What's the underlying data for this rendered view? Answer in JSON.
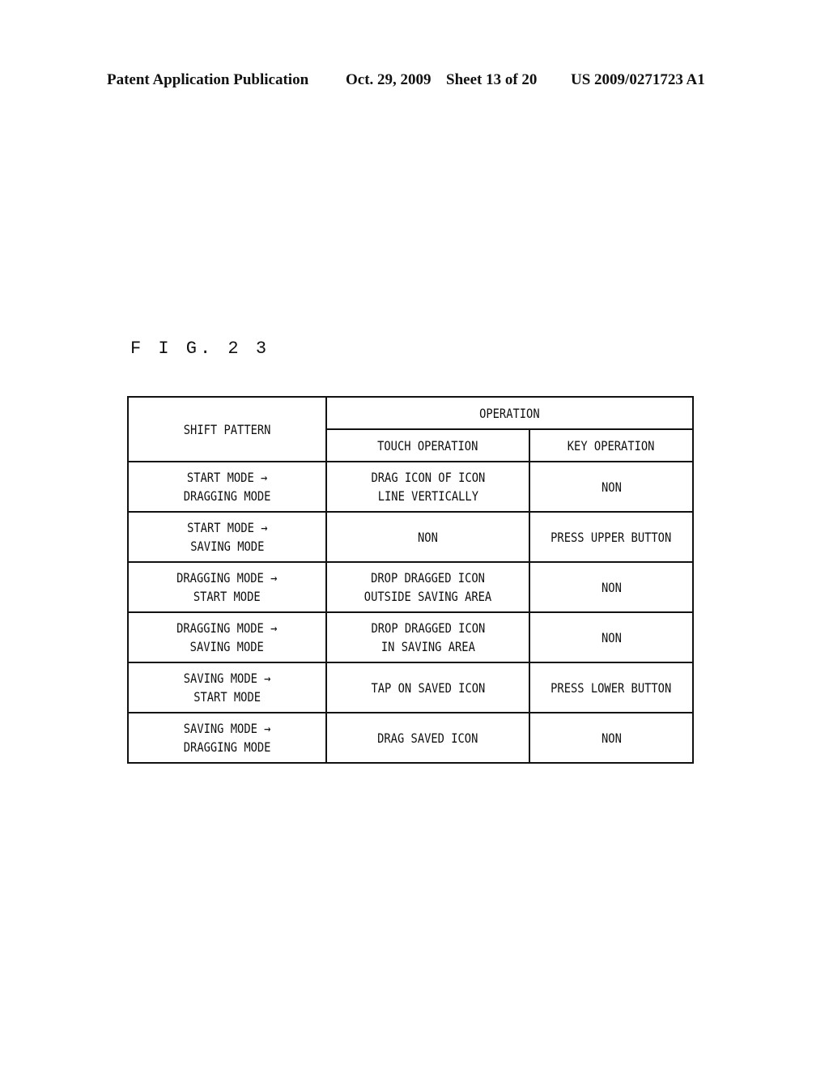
{
  "header": {
    "publication": "Patent Application Publication",
    "date": "Oct. 29, 2009",
    "sheet": "Sheet 13 of 20",
    "number": "US 2009/0271723 A1"
  },
  "figure": {
    "label": "F I G. 2 3"
  },
  "table": {
    "headers": {
      "shift_pattern": "SHIFT PATTERN",
      "operation": "OPERATION",
      "touch_operation": "TOUCH OPERATION",
      "key_operation": "KEY OPERATION"
    },
    "rows": [
      {
        "shift_pattern": "START MODE →\nDRAGGING MODE",
        "touch_operation": "DRAG ICON OF ICON\nLINE VERTICALLY",
        "key_operation": "NON"
      },
      {
        "shift_pattern": "START MODE →\nSAVING MODE",
        "touch_operation": "NON",
        "key_operation": "PRESS UPPER BUTTON"
      },
      {
        "shift_pattern": "DRAGGING MODE →\nSTART MODE",
        "touch_operation": "DROP DRAGGED ICON\nOUTSIDE SAVING AREA",
        "key_operation": "NON"
      },
      {
        "shift_pattern": "DRAGGING MODE →\nSAVING MODE",
        "touch_operation": "DROP DRAGGED ICON\nIN SAVING AREA",
        "key_operation": "NON"
      },
      {
        "shift_pattern": "SAVING MODE →\nSTART MODE",
        "touch_operation": "TAP ON SAVED ICON",
        "key_operation": "PRESS LOWER BUTTON"
      },
      {
        "shift_pattern": "SAVING MODE →\nDRAGGING MODE",
        "touch_operation": "DRAG SAVED ICON",
        "key_operation": "NON"
      }
    ]
  }
}
